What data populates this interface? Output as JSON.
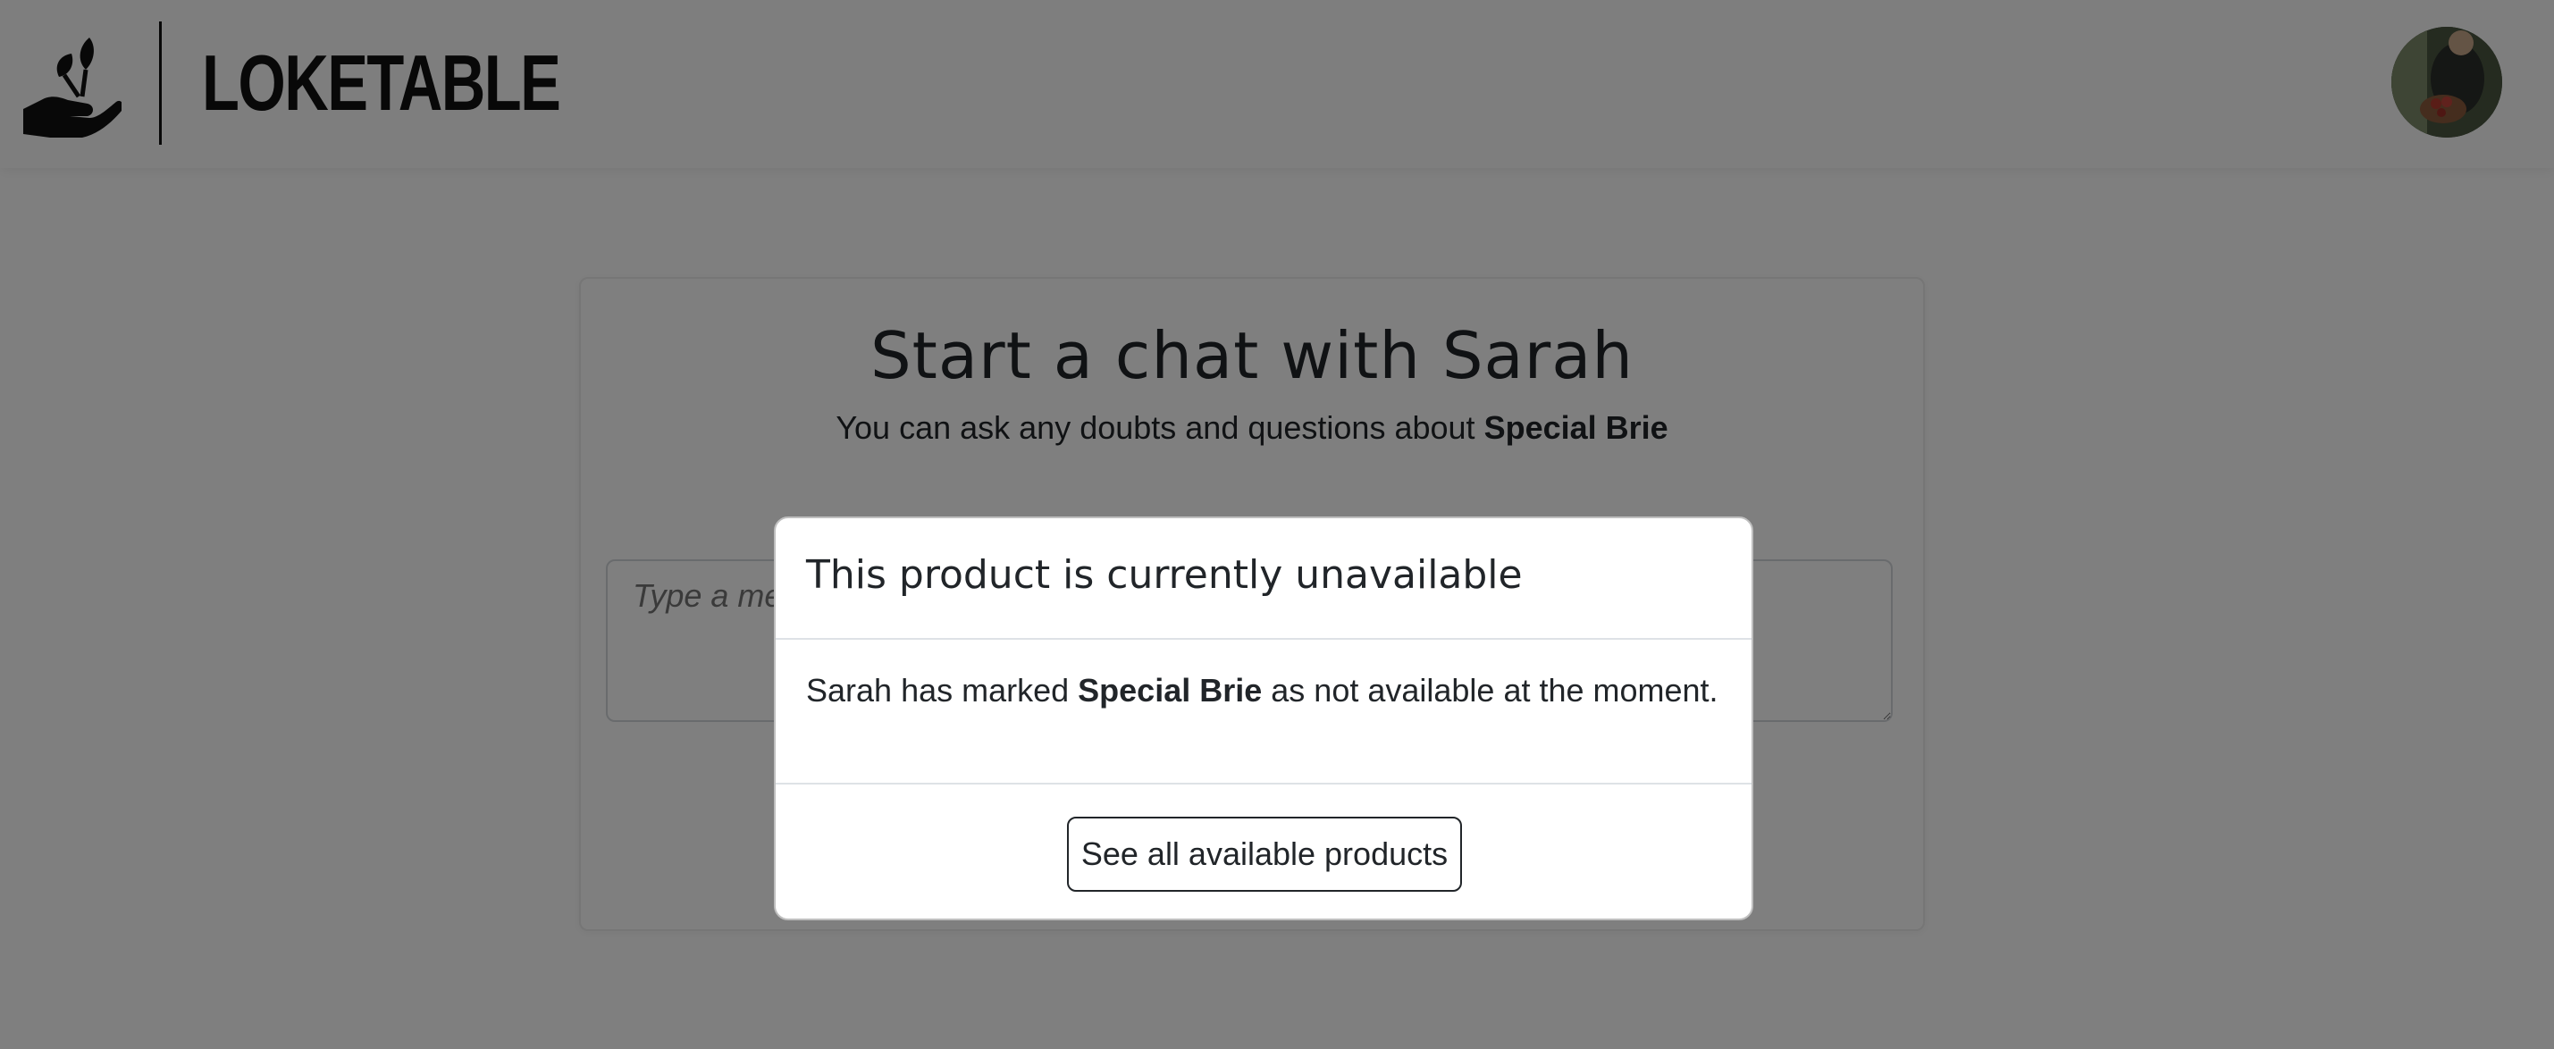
{
  "header": {
    "brand_name": "LOKETABLE",
    "logo_icon": "hand-sprout-icon",
    "avatar_icon": "user-avatar"
  },
  "chat": {
    "title": "Start a chat with Sarah",
    "subtitle_prefix": "You can ask any doubts and questions about ",
    "product_name": "Special Brie",
    "message_placeholder": "Type a message"
  },
  "modal": {
    "title": "This product is currently unavailable",
    "body_prefix": "Sarah has marked ",
    "body_product": "Special Brie",
    "body_suffix": " as not available at the moment.",
    "button_label": "See all available products"
  },
  "colors": {
    "overlay": "#000000",
    "text": "#212529",
    "border": "#dee2e6"
  }
}
